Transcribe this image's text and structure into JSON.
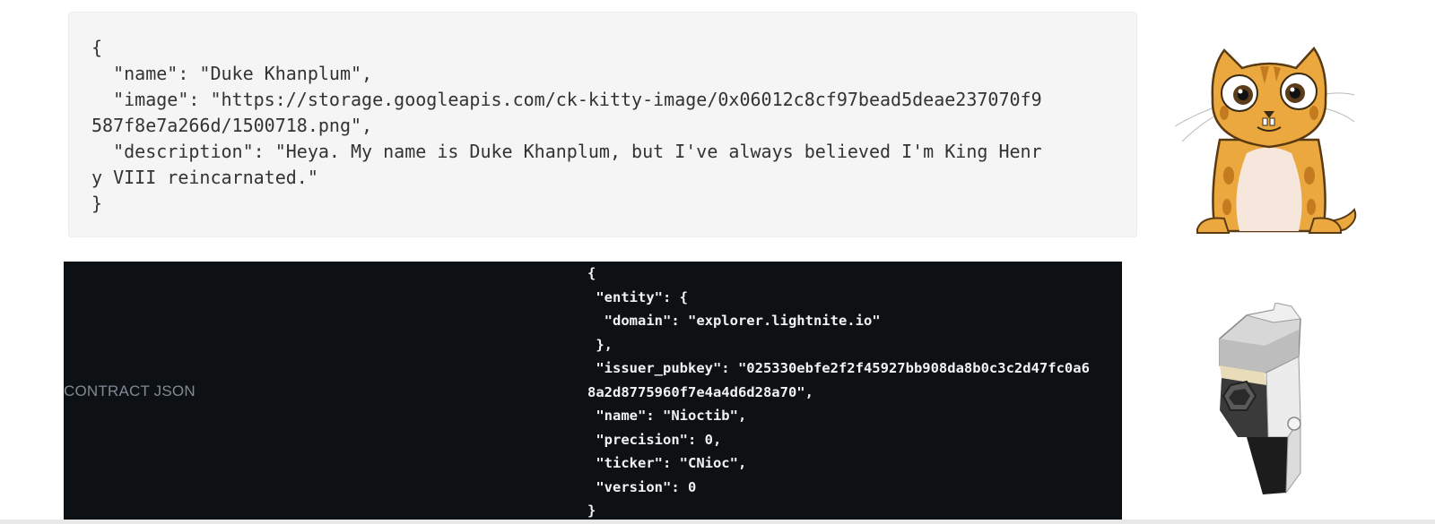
{
  "light_code": {
    "lines": [
      "{",
      "  \"name\": \"Duke Khanplum\",",
      "  \"image\": \"https://storage.googleapis.com/ck-kitty-image/0x06012c8cf97bead5deae237070f9",
      "587f8e7a266d/1500718.png\",",
      "  \"description\": \"Heya. My name is Duke Khanplum, but I've always believed I'm King Henr",
      "y VIII reincarnated.\"",
      "}"
    ]
  },
  "contract_section": {
    "label": "CONTRACT JSON",
    "lines": [
      "{",
      " \"entity\": {",
      "  \"domain\": \"explorer.lightnite.io\"",
      " },",
      " \"issuer_pubkey\": \"025330ebfe2f2f45927bb908da8b0c3c2d47fc0a6",
      "8a2d8775960f7e4a4d6d28a70\",",
      " \"name\": \"Nioctib\",",
      " \"precision\": 0,",
      " \"ticker\": \"CNioc\",",
      " \"version\": 0",
      "}"
    ]
  },
  "images": {
    "kitty": "cryptokitty-image",
    "token": "robot-token-image"
  },
  "colors": {
    "light_code_bg": "#f5f5f5",
    "dark_code_bg": "#0d1114",
    "label_color": "#7f8a94"
  }
}
